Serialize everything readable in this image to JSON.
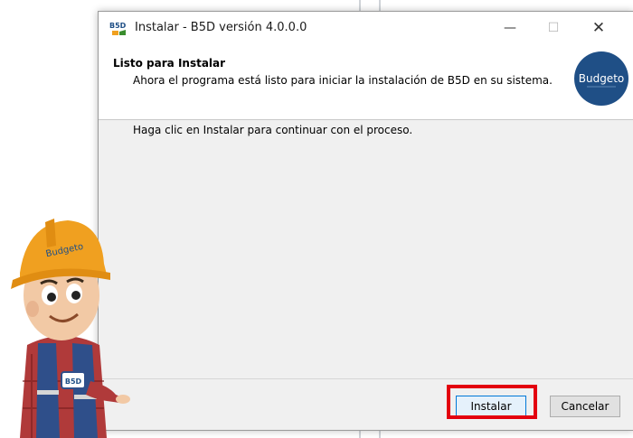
{
  "window": {
    "title": "Instalar - B5D versión 4.0.0.0",
    "controls": {
      "minimize": "—",
      "maximize": "☐",
      "close": "✕"
    },
    "app_icon_text": "B5D"
  },
  "header": {
    "title": "Listo para Instalar",
    "subtitle": "Ahora el programa está listo para iniciar la instalación de B5D en su sistema.",
    "logo_text": "Budgeto"
  },
  "body": {
    "instruction": "Haga clic en Instalar para continuar con el proceso."
  },
  "buttons": {
    "install": "Instalar",
    "cancel": "Cancelar"
  },
  "colors": {
    "highlight": "#e3000f",
    "logo_bg": "#1f4f86",
    "helmet": "#f0a020"
  },
  "mascot": {
    "helmet_text": "Budgeto",
    "vest_text": "B5D"
  }
}
